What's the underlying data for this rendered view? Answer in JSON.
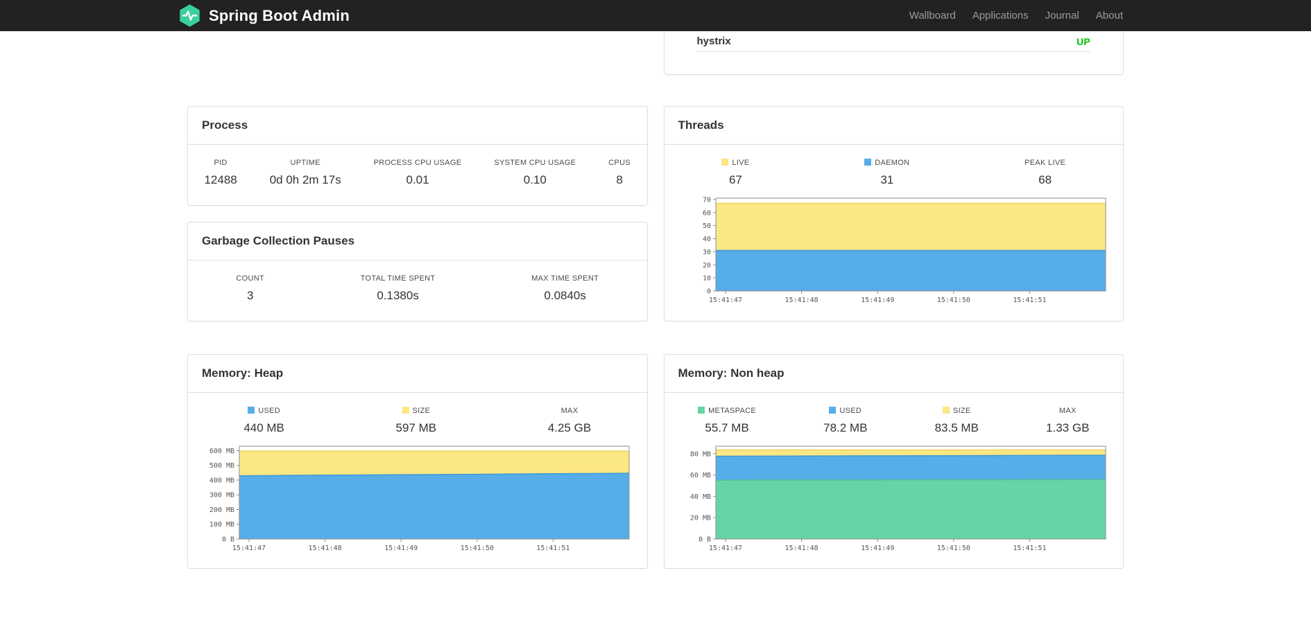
{
  "navbar": {
    "brand": "Spring Boot Admin",
    "links": [
      {
        "label": "Wallboard"
      },
      {
        "label": "Applications"
      },
      {
        "label": "Journal"
      },
      {
        "label": "About"
      }
    ]
  },
  "application_row": {
    "name": "hystrix",
    "status": "UP",
    "status_color": "#00c000"
  },
  "process": {
    "title": "Process",
    "stats": [
      {
        "label": "PID",
        "value": "12488"
      },
      {
        "label": "UPTIME",
        "value": "0d 0h 2m 17s"
      },
      {
        "label": "PROCESS CPU USAGE",
        "value": "0.01"
      },
      {
        "label": "SYSTEM CPU USAGE",
        "value": "0.10"
      },
      {
        "label": "CPUS",
        "value": "8"
      }
    ]
  },
  "gc": {
    "title": "Garbage Collection Pauses",
    "stats": [
      {
        "label": "COUNT",
        "value": "3"
      },
      {
        "label": "TOTAL TIME SPENT",
        "value": "0.1380s"
      },
      {
        "label": "MAX TIME SPENT",
        "value": "0.0840s"
      }
    ]
  },
  "threads": {
    "title": "Threads",
    "legend": [
      {
        "label": "LIVE",
        "value": "67",
        "color": "#fbe783"
      },
      {
        "label": "DAEMON",
        "value": "31",
        "color": "#56ade8"
      },
      {
        "label": "PEAK LIVE",
        "value": "68",
        "color": null
      }
    ]
  },
  "memory_heap": {
    "title": "Memory: Heap",
    "legend": [
      {
        "label": "USED",
        "value": "440 MB",
        "color": "#56ade8"
      },
      {
        "label": "SIZE",
        "value": "597 MB",
        "color": "#fbe783"
      },
      {
        "label": "MAX",
        "value": "4.25 GB",
        "color": null
      }
    ]
  },
  "memory_nonheap": {
    "title": "Memory: Non heap",
    "legend": [
      {
        "label": "METASPACE",
        "value": "55.7 MB",
        "color": "#68d3a7"
      },
      {
        "label": "USED",
        "value": "78.2 MB",
        "color": "#56ade8"
      },
      {
        "label": "SIZE",
        "value": "83.5 MB",
        "color": "#fbe783"
      },
      {
        "label": "MAX",
        "value": "1.33 GB",
        "color": null
      }
    ]
  },
  "brand_color": "#3acf9e",
  "chart_data": [
    {
      "id": "threads",
      "type": "area",
      "title": "Threads",
      "legend_position": "top",
      "grid": false,
      "x_ticks": [
        "15:41:47",
        "15:41:48",
        "15:41:49",
        "15:41:50",
        "15:41:51"
      ],
      "y_ticks": [
        {
          "v": 0,
          "label": "0"
        },
        {
          "v": 10,
          "label": "10"
        },
        {
          "v": 20,
          "label": "20"
        },
        {
          "v": 30,
          "label": "30"
        },
        {
          "v": 40,
          "label": "40"
        },
        {
          "v": 50,
          "label": "50"
        },
        {
          "v": 60,
          "label": "60"
        },
        {
          "v": 70,
          "label": "70"
        }
      ],
      "ylim": [
        0,
        71
      ],
      "series": [
        {
          "name": "LIVE",
          "color": "#fbe783",
          "stroke": "#ecd45f",
          "values": [
            67,
            67,
            67,
            67,
            67,
            67
          ]
        },
        {
          "name": "DAEMON",
          "color": "#56ade8",
          "stroke": "#3d98d9",
          "values": [
            31,
            31,
            31,
            31,
            31,
            31
          ]
        }
      ]
    },
    {
      "id": "memory-heap",
      "type": "area",
      "title": "Memory: Heap",
      "legend_position": "top",
      "grid": false,
      "x_ticks": [
        "15:41:47",
        "15:41:48",
        "15:41:49",
        "15:41:50",
        "15:41:51"
      ],
      "y_ticks": [
        {
          "v": 0,
          "label": "0 B"
        },
        {
          "v": 100,
          "label": "100 MB"
        },
        {
          "v": 200,
          "label": "200 MB"
        },
        {
          "v": 300,
          "label": "300 MB"
        },
        {
          "v": 400,
          "label": "400 MB"
        },
        {
          "v": 500,
          "label": "500 MB"
        },
        {
          "v": 600,
          "label": "600 MB"
        }
      ],
      "ylim": [
        0,
        630
      ],
      "series": [
        {
          "name": "SIZE",
          "color": "#fbe783",
          "stroke": "#ecd45f",
          "values": [
            597,
            597,
            597,
            597,
            597,
            597
          ]
        },
        {
          "name": "USED",
          "color": "#56ade8",
          "stroke": "#3d98d9",
          "values": [
            429,
            433,
            436,
            439,
            443,
            446
          ]
        }
      ]
    },
    {
      "id": "memory-nonheap",
      "type": "area",
      "title": "Memory: Non heap",
      "legend_position": "top",
      "grid": false,
      "x_ticks": [
        "15:41:47",
        "15:41:48",
        "15:41:49",
        "15:41:50",
        "15:41:51"
      ],
      "y_ticks": [
        {
          "v": 0,
          "label": "0 B"
        },
        {
          "v": 20,
          "label": "20 MB"
        },
        {
          "v": 40,
          "label": "40 MB"
        },
        {
          "v": 60,
          "label": "60 MB"
        },
        {
          "v": 80,
          "label": "80 MB"
        }
      ],
      "ylim": [
        0,
        87
      ],
      "series": [
        {
          "name": "SIZE",
          "color": "#fbe783",
          "stroke": "#ecd45f",
          "values": [
            83.5,
            83.5,
            83.5,
            83.5,
            83.5,
            83.5
          ]
        },
        {
          "name": "USED",
          "color": "#56ade8",
          "stroke": "#3d98d9",
          "values": [
            77.6,
            77.8,
            78.0,
            78.1,
            78.3,
            78.5
          ]
        },
        {
          "name": "METASPACE",
          "color": "#68d3a7",
          "stroke": "#4cc290",
          "values": [
            55.2,
            55.3,
            55.4,
            55.5,
            55.6,
            55.7
          ]
        }
      ]
    }
  ]
}
